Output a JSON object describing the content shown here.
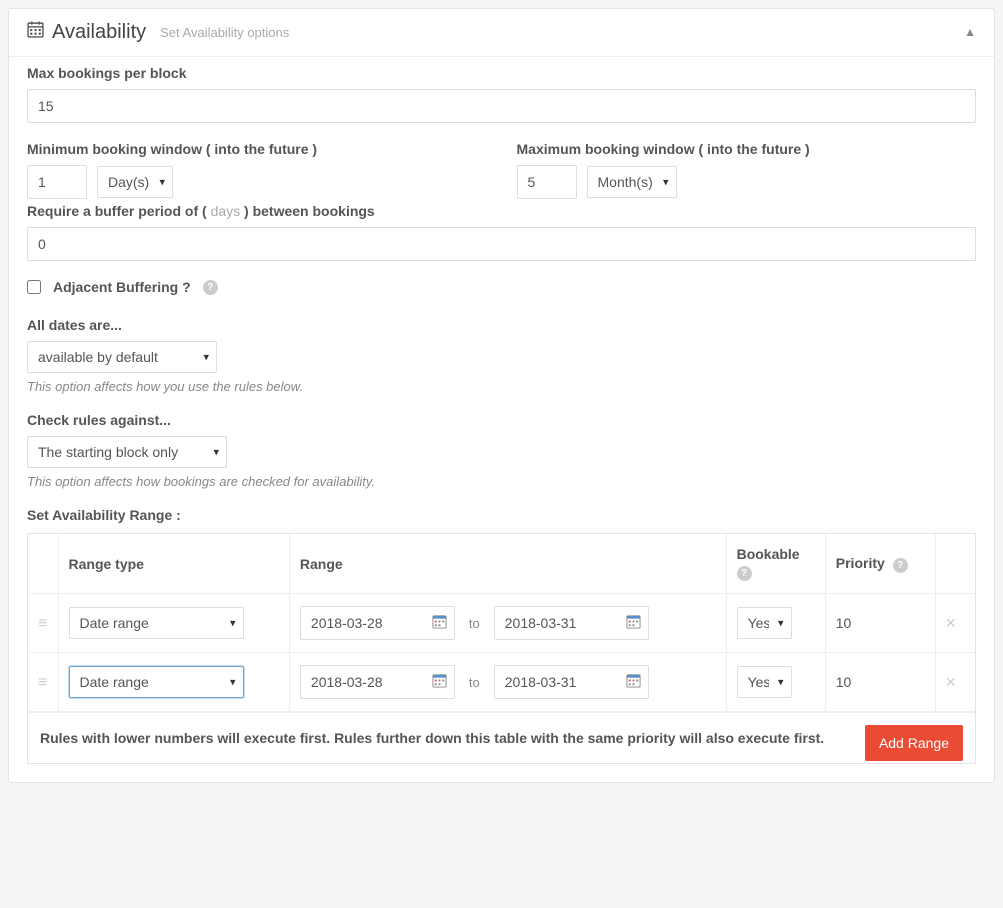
{
  "panel": {
    "title": "Availability",
    "subtitle": "Set Availability options"
  },
  "max_bookings": {
    "label": "Max bookings per block",
    "value": "15"
  },
  "min_window": {
    "label": "Minimum booking window ( into the future )",
    "value": "1",
    "unit": "Day(s)"
  },
  "max_window": {
    "label": "Maximum booking window ( into the future )",
    "value": "5",
    "unit": "Month(s)"
  },
  "buffer": {
    "label_pre": "Require a buffer period of ( ",
    "label_mid": "days",
    "label_post": " ) between bookings",
    "value": "0"
  },
  "adjacent": {
    "label": "Adjacent Buffering ?",
    "checked": false
  },
  "all_dates": {
    "label": "All dates are...",
    "value": "available by default",
    "help": "This option affects how you use the rules below."
  },
  "check_rules": {
    "label": "Check rules against...",
    "value": "The starting block only",
    "help": "This option affects how bookings are checked for availability."
  },
  "range_section": {
    "label": "Set Availability Range :",
    "headers": {
      "range_type": "Range type",
      "range": "Range",
      "bookable": "Bookable",
      "priority": "Priority"
    },
    "to_text": "to",
    "rows": [
      {
        "type": "Date range",
        "from": "2018-03-28",
        "to": "2018-03-31",
        "bookable": "Yes",
        "priority": "10",
        "focused": false
      },
      {
        "type": "Date range",
        "from": "2018-03-28",
        "to": "2018-03-31",
        "bookable": "Yes",
        "priority": "10",
        "focused": true
      }
    ],
    "footer_note": "Rules with lower numbers will execute first. Rules further down this table with the same priority will also execute first.",
    "add_button": "Add Range"
  }
}
